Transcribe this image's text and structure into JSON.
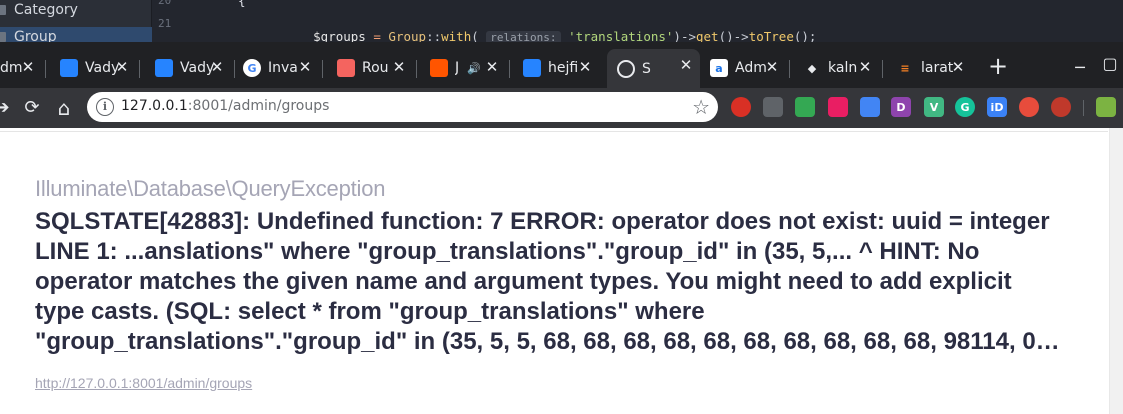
{
  "ide": {
    "sidebar_items": [
      "Category",
      "Group"
    ],
    "line_numbers": [
      "20",
      "21"
    ],
    "code_line_top": "{",
    "code": {
      "var": "$groups",
      "eq": " = ",
      "cls": "Group",
      "sep": "::",
      "fn_with": "with",
      "paren_open": "( ",
      "hint": "relations:",
      "str": "'translations'",
      "rest_a": ")->",
      "fn_get": "get",
      "rest_b": "()->",
      "fn_tree": "toTree",
      "rest_c": "();"
    }
  },
  "browser": {
    "tabs": [
      {
        "title": "dm",
        "icon": "partial-icon",
        "color": "#3c4043"
      },
      {
        "title": "Vady",
        "icon": "bitbucket-icon",
        "color": "#2684ff"
      },
      {
        "title": "Vady",
        "icon": "bitbucket-icon",
        "color": "#2684ff"
      },
      {
        "title": "Inva",
        "icon": "google-icon",
        "color": "#ffffff"
      },
      {
        "title": "Rou",
        "icon": "laravel-icon",
        "color": "#f4645f"
      },
      {
        "title": "J",
        "icon": "soundcloud-icon",
        "color": "#ff5500",
        "audio": "🔊"
      },
      {
        "title": "hejfi",
        "icon": "bitbucket-icon",
        "color": "#2684ff"
      },
      {
        "title": "S",
        "icon": "globe-icon",
        "color": "#9aa0a6",
        "active": true
      },
      {
        "title": "Adm",
        "icon": "a-logo-icon",
        "color": "#1a73e8"
      },
      {
        "title": "kaln",
        "icon": "gem-icon",
        "color": "#ffffff"
      },
      {
        "title": "larat",
        "icon": "stackoverflow-icon",
        "color": "#f48024"
      }
    ],
    "new_tab": "+",
    "url_host": "127.0.0.1",
    "url_rest": ":8001/admin/groups",
    "bookmark_star": "☆",
    "extensions": [
      {
        "name": "shield-red-icon",
        "color": "#d93025",
        "label": ""
      },
      {
        "name": "camera-icon",
        "color": "#5f6368",
        "label": ""
      },
      {
        "name": "colorful-cube-icon",
        "color": "#34a853",
        "label": ""
      },
      {
        "name": "dots-icon",
        "color": "#e91e63",
        "label": ""
      },
      {
        "name": "camera-blue-icon",
        "color": "#4285f4",
        "label": ""
      },
      {
        "name": "d-purple-icon",
        "color": "#8e44ad",
        "label": "D"
      },
      {
        "name": "vue-icon",
        "color": "#41b883",
        "label": "V"
      },
      {
        "name": "grammarly-icon",
        "color": "#15c39a",
        "label": "G"
      },
      {
        "name": "id-icon",
        "color": "#3b82f6",
        "label": "iD"
      },
      {
        "name": "shield-pink-icon",
        "color": "#e74c3c",
        "label": ""
      },
      {
        "name": "hand-red-icon",
        "color": "#c0392b",
        "label": ""
      },
      {
        "name": "user-avatar-icon",
        "color": "#7cb342",
        "label": ""
      }
    ]
  },
  "error": {
    "exception_class": "Illuminate\\Database\\QueryException",
    "message_lines": [
      "SQLSTATE[42883]: Undefined function: 7 ERROR: operator does not exist: uuid = integer",
      "LINE 1: ...anslations\" where \"group_translations\".\"group_id\" in (35, 5,... ^ HINT: No",
      "operator matches the given name and argument types. You might need to add explicit",
      "type casts. (SQL: select * from \"group_translations\" where",
      "\"group_translations\".\"group_id\" in (35, 5, 5, 68, 68, 68, 68, 68, 68, 68, 68, 68, 68, 98114, 0…"
    ],
    "request_url": "http://127.0.0.1:8001/admin/groups"
  }
}
